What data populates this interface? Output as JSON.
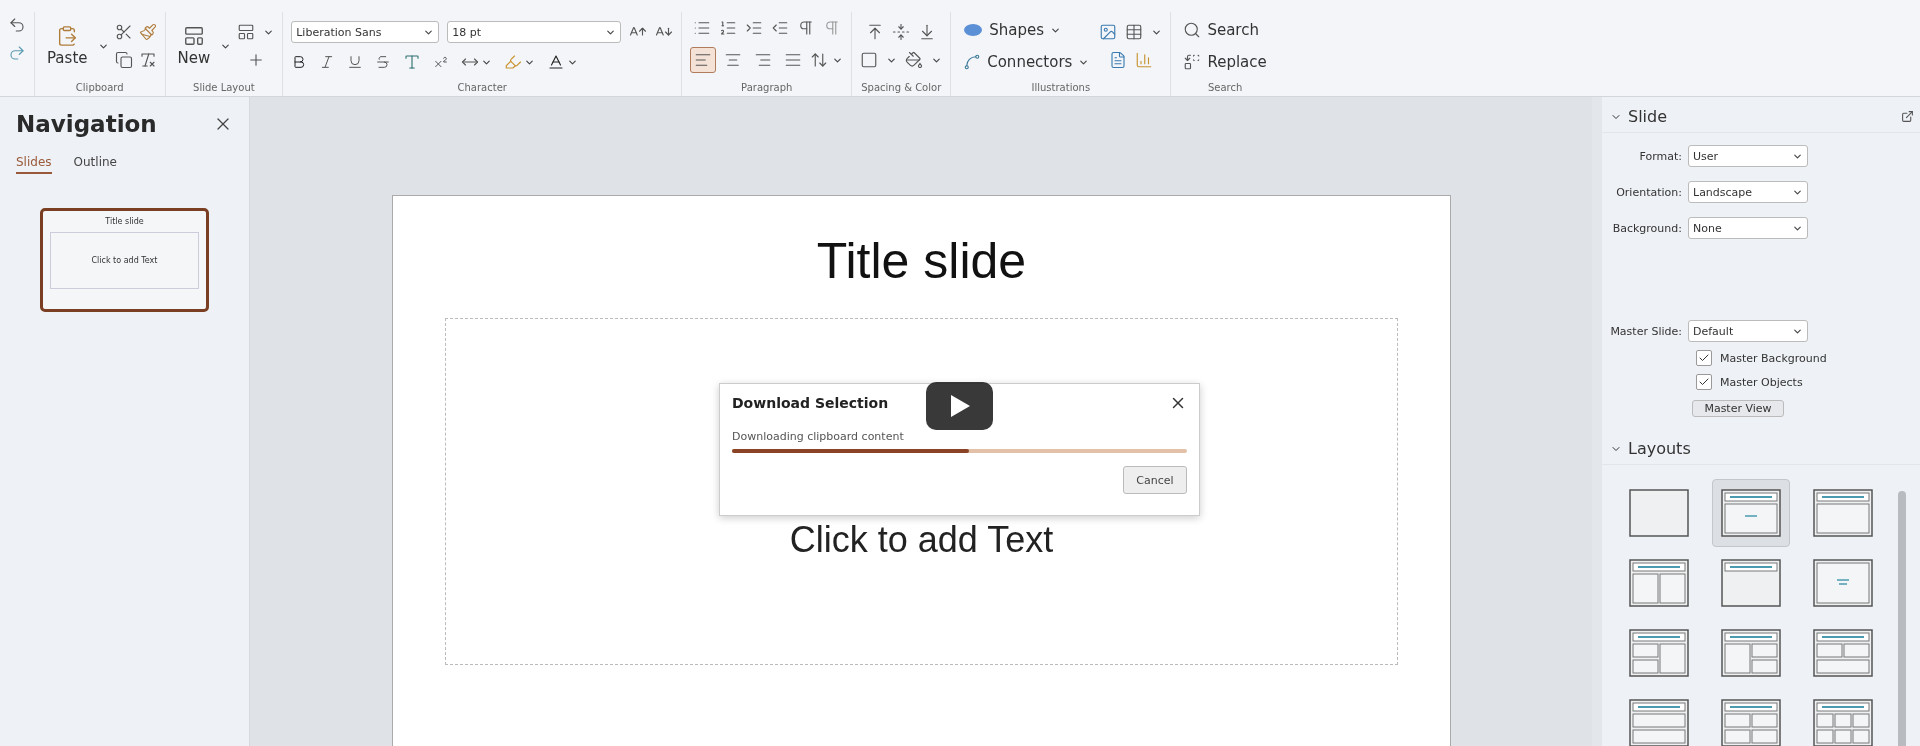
{
  "toolbar": {
    "clipboard": {
      "label": "Clipboard",
      "paste": "Paste"
    },
    "slide_layout": {
      "label": "Slide Layout",
      "new": "New"
    },
    "character": {
      "label": "Character",
      "font_name": "Liberation Sans",
      "font_size": "18 pt"
    },
    "paragraph": {
      "label": "Paragraph",
      "alignments": [
        {
          "kind": "left",
          "selected": true
        },
        {
          "kind": "center",
          "selected": false
        },
        {
          "kind": "right",
          "selected": false
        },
        {
          "kind": "justify",
          "selected": false
        }
      ]
    },
    "spacing_color": {
      "label": "Spacing & Color"
    },
    "illustrations": {
      "label": "Illustrations",
      "shapes": "Shapes",
      "connectors": "Connectors"
    },
    "search": {
      "label": "Search",
      "search": "Search",
      "replace": "Replace"
    }
  },
  "navigation": {
    "title": "Navigation",
    "tabs": [
      {
        "label": "Slides",
        "selected": true
      },
      {
        "label": "Outline",
        "selected": false
      }
    ],
    "slides": [
      {
        "title": "Title slide",
        "body": "Click to add Text",
        "selected": true
      }
    ]
  },
  "slide": {
    "title": "Title slide",
    "body": "Click to add Text"
  },
  "dialog": {
    "title": "Download Selection",
    "message": "Downloading clipboard content",
    "level": 0.52,
    "cancel": "Cancel"
  },
  "sidebar": {
    "slide": {
      "title": "Slide",
      "expanded": true,
      "fields": [
        {
          "label": "Format:",
          "value": "User"
        },
        {
          "label": "Orientation:",
          "value": "Landscape"
        },
        {
          "label": "Background:",
          "value": "None"
        }
      ],
      "master": {
        "label": "Master Slide:",
        "value": "Default"
      },
      "checkboxes": [
        {
          "label": "Master Background",
          "checked": true
        },
        {
          "label": "Master Objects",
          "checked": true
        }
      ],
      "button": "Master View"
    },
    "layouts": {
      "title": "Layouts",
      "expanded": true,
      "items": [
        {
          "kind": "blank",
          "selected": false
        },
        {
          "kind": "title-subtitle",
          "selected": true
        },
        {
          "kind": "title-content",
          "selected": false
        },
        {
          "kind": "title-two-columns",
          "selected": false
        },
        {
          "kind": "title-only",
          "selected": false
        },
        {
          "kind": "centered-text",
          "selected": false
        },
        {
          "kind": "title-2left-1right",
          "selected": false
        },
        {
          "kind": "title-1left-2right",
          "selected": false
        },
        {
          "kind": "title-2top-1bottom",
          "selected": false
        },
        {
          "kind": "title-two-rows",
          "selected": false
        },
        {
          "kind": "title-four",
          "selected": false
        },
        {
          "kind": "title-six",
          "selected": false
        }
      ]
    }
  }
}
